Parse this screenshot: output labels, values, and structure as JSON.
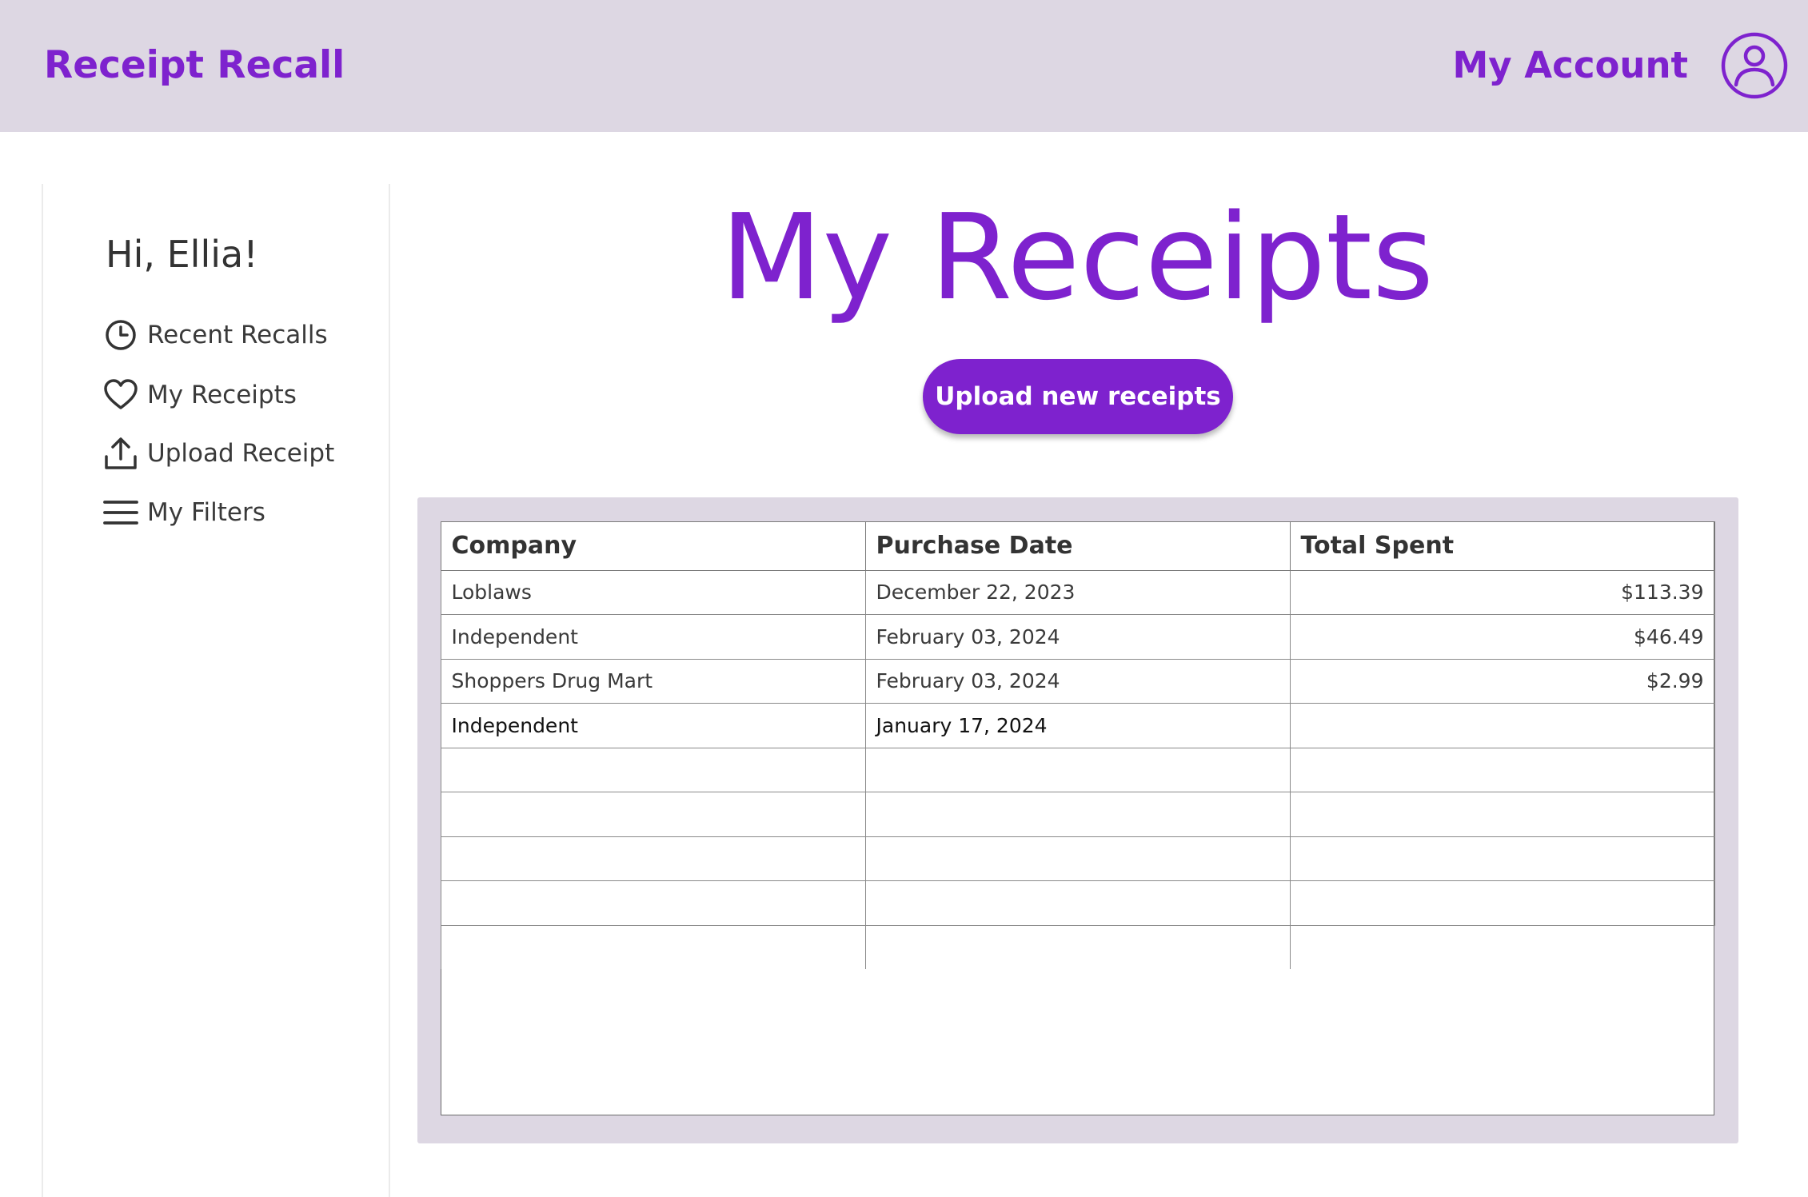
{
  "header": {
    "brand": "Receipt Recall",
    "account_label": "My Account",
    "avatar_icon": "user-circle-icon"
  },
  "sidebar": {
    "greeting": "Hi, Ellia!",
    "items": [
      {
        "label": "Recent Recalls",
        "icon": "clock-icon"
      },
      {
        "label": "My Receipts",
        "icon": "heart-icon"
      },
      {
        "label": "Upload Receipt",
        "icon": "upload-icon"
      },
      {
        "label": "My Filters",
        "icon": "menu-icon"
      }
    ]
  },
  "main": {
    "title": "My Receipts",
    "upload_button": "Upload new receipts",
    "table": {
      "columns": [
        "Company",
        "Purchase Date",
        "Total Spent"
      ],
      "rows": [
        {
          "company": "Loblaws",
          "date": "December 22, 2023",
          "total": "$113.39"
        },
        {
          "company": "Independent",
          "date": "February 03, 2024",
          "total": "$46.49"
        },
        {
          "company": "Shoppers Drug Mart",
          "date": "February 03, 2024",
          "total": "$2.99"
        },
        {
          "company": "Independent",
          "date": "January 17, 2024",
          "total": ""
        }
      ]
    }
  },
  "colors": {
    "accent": "#7e22ce",
    "header_bg": "#ddd7e3",
    "panel_bg": "#ddd7e3"
  }
}
